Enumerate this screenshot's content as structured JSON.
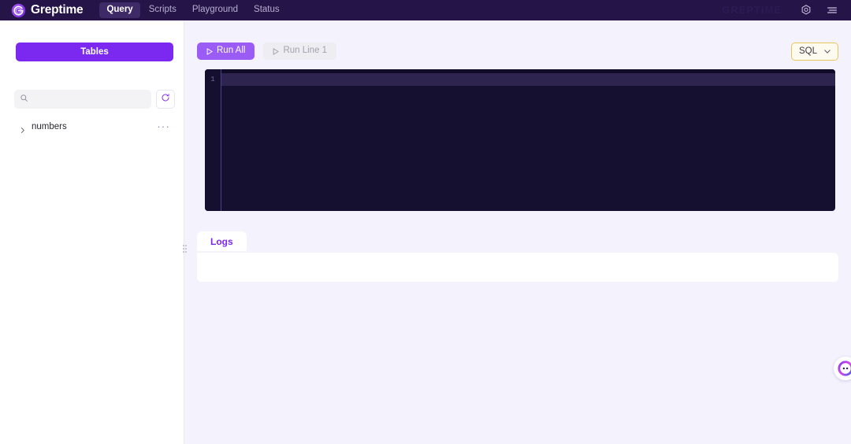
{
  "app": {
    "brand": "Greptime",
    "brand_logo_icon": "greptime-spiral-logo-icon",
    "header_bg": "#241447",
    "accent": "#7b28f0",
    "watermark": "GREPTIME"
  },
  "nav": {
    "items": [
      {
        "label": "Query",
        "active": true
      },
      {
        "label": "Scripts",
        "active": false
      },
      {
        "label": "Playground",
        "active": false
      },
      {
        "label": "Status",
        "active": false
      }
    ],
    "icons": [
      {
        "name": "settings-gear-icon"
      },
      {
        "name": "hamburger-menu-icon"
      }
    ]
  },
  "sidebar": {
    "tables_button_label": "Tables",
    "search": {
      "value": "",
      "placeholder": "",
      "icon": "search-icon"
    },
    "refresh_icon": "refresh-icon",
    "tables": [
      {
        "name": "numbers",
        "expanded": false,
        "more_label": "···"
      }
    ]
  },
  "toolbar": {
    "run_all_label": "Run All",
    "run_line_label": "Run Line 1",
    "run_icon": "play-triangle-icon",
    "language_label": "SQL",
    "language_caret_icon": "chevron-down-icon",
    "language_border_color": "#e6c75f"
  },
  "editor": {
    "line_numbers": [
      "1"
    ],
    "content": "",
    "background": "#150f30",
    "active_line_color": "#2d2550",
    "cursor_line": 1
  },
  "logs": {
    "tab_label": "Logs",
    "tab_color": "#7b28f0",
    "body_text": ""
  },
  "widgets": {
    "chat_icon": "chat-support-face-icon"
  }
}
